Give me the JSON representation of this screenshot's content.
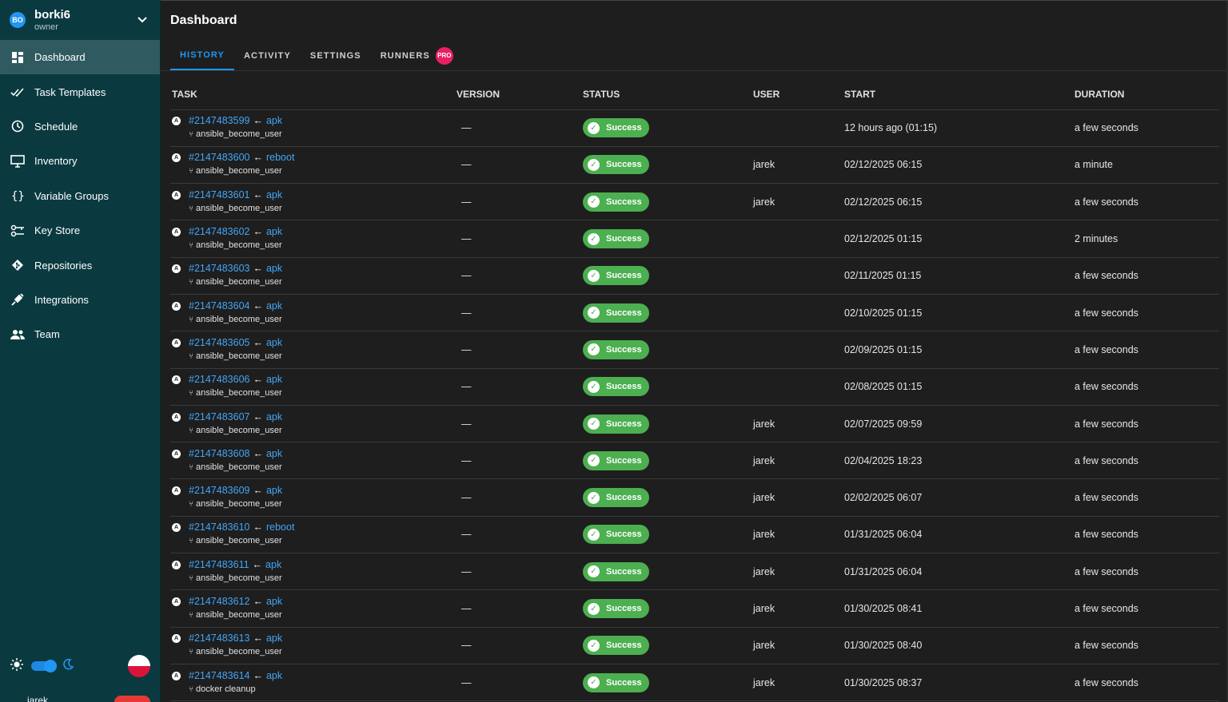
{
  "project": {
    "initials": "BO",
    "name": "borki6",
    "role": "owner"
  },
  "nav": [
    {
      "label": "Dashboard",
      "icon": "dashboard-icon",
      "active": true
    },
    {
      "label": "Task Templates",
      "icon": "double-check-icon",
      "active": false
    },
    {
      "label": "Schedule",
      "icon": "clock-icon",
      "active": false
    },
    {
      "label": "Inventory",
      "icon": "monitor-icon",
      "active": false
    },
    {
      "label": "Variable Groups",
      "icon": "braces-icon",
      "active": false
    },
    {
      "label": "Key Store",
      "icon": "key-icon",
      "active": false
    },
    {
      "label": "Repositories",
      "icon": "git-icon",
      "active": false
    },
    {
      "label": "Integrations",
      "icon": "plug-icon",
      "active": false
    },
    {
      "label": "Team",
      "icon": "team-icon",
      "active": false
    }
  ],
  "footer": {
    "user": "jarek"
  },
  "page": {
    "title": "Dashboard"
  },
  "tabs": [
    {
      "label": "HISTORY",
      "active": true
    },
    {
      "label": "ACTIVITY",
      "active": false
    },
    {
      "label": "SETTINGS",
      "active": false
    },
    {
      "label": "RUNNERS",
      "active": false,
      "badge": "PRO"
    }
  ],
  "table": {
    "headers": {
      "task": "TASK",
      "version": "VERSION",
      "status": "STATUS",
      "user": "USER",
      "start": "START",
      "duration": "DURATION"
    },
    "rows": [
      {
        "id": "#2147483599",
        "template": "apk",
        "branch": "ansible_become_user",
        "version": "—",
        "status": "Success",
        "user": "",
        "start": "12 hours ago (01:15)",
        "duration": "a few seconds"
      },
      {
        "id": "#2147483600",
        "template": "reboot",
        "branch": "ansible_become_user",
        "version": "—",
        "status": "Success",
        "user": "jarek",
        "start": "02/12/2025 06:15",
        "duration": "a minute"
      },
      {
        "id": "#2147483601",
        "template": "apk",
        "branch": "ansible_become_user",
        "version": "—",
        "status": "Success",
        "user": "jarek",
        "start": "02/12/2025 06:15",
        "duration": "a few seconds"
      },
      {
        "id": "#2147483602",
        "template": "apk",
        "branch": "ansible_become_user",
        "version": "—",
        "status": "Success",
        "user": "",
        "start": "02/12/2025 01:15",
        "duration": "2 minutes"
      },
      {
        "id": "#2147483603",
        "template": "apk",
        "branch": "ansible_become_user",
        "version": "—",
        "status": "Success",
        "user": "",
        "start": "02/11/2025 01:15",
        "duration": "a few seconds"
      },
      {
        "id": "#2147483604",
        "template": "apk",
        "branch": "ansible_become_user",
        "version": "—",
        "status": "Success",
        "user": "",
        "start": "02/10/2025 01:15",
        "duration": "a few seconds"
      },
      {
        "id": "#2147483605",
        "template": "apk",
        "branch": "ansible_become_user",
        "version": "—",
        "status": "Success",
        "user": "",
        "start": "02/09/2025 01:15",
        "duration": "a few seconds"
      },
      {
        "id": "#2147483606",
        "template": "apk",
        "branch": "ansible_become_user",
        "version": "—",
        "status": "Success",
        "user": "",
        "start": "02/08/2025 01:15",
        "duration": "a few seconds"
      },
      {
        "id": "#2147483607",
        "template": "apk",
        "branch": "ansible_become_user",
        "version": "—",
        "status": "Success",
        "user": "jarek",
        "start": "02/07/2025 09:59",
        "duration": "a few seconds"
      },
      {
        "id": "#2147483608",
        "template": "apk",
        "branch": "ansible_become_user",
        "version": "—",
        "status": "Success",
        "user": "jarek",
        "start": "02/04/2025 18:23",
        "duration": "a few seconds"
      },
      {
        "id": "#2147483609",
        "template": "apk",
        "branch": "ansible_become_user",
        "version": "—",
        "status": "Success",
        "user": "jarek",
        "start": "02/02/2025 06:07",
        "duration": "a few seconds"
      },
      {
        "id": "#2147483610",
        "template": "reboot",
        "branch": "ansible_become_user",
        "version": "—",
        "status": "Success",
        "user": "jarek",
        "start": "01/31/2025 06:04",
        "duration": "a few seconds"
      },
      {
        "id": "#2147483611",
        "template": "apk",
        "branch": "ansible_become_user",
        "version": "—",
        "status": "Success",
        "user": "jarek",
        "start": "01/31/2025 06:04",
        "duration": "a few seconds"
      },
      {
        "id": "#2147483612",
        "template": "apk",
        "branch": "ansible_become_user",
        "version": "—",
        "status": "Success",
        "user": "jarek",
        "start": "01/30/2025 08:41",
        "duration": "a few seconds"
      },
      {
        "id": "#2147483613",
        "template": "apk",
        "branch": "ansible_become_user",
        "version": "—",
        "status": "Success",
        "user": "jarek",
        "start": "01/30/2025 08:40",
        "duration": "a few seconds"
      },
      {
        "id": "#2147483614",
        "template": "apk",
        "branch": "docker cleanup",
        "version": "—",
        "status": "Success",
        "user": "jarek",
        "start": "01/30/2025 08:37",
        "duration": "a few seconds"
      }
    ]
  }
}
